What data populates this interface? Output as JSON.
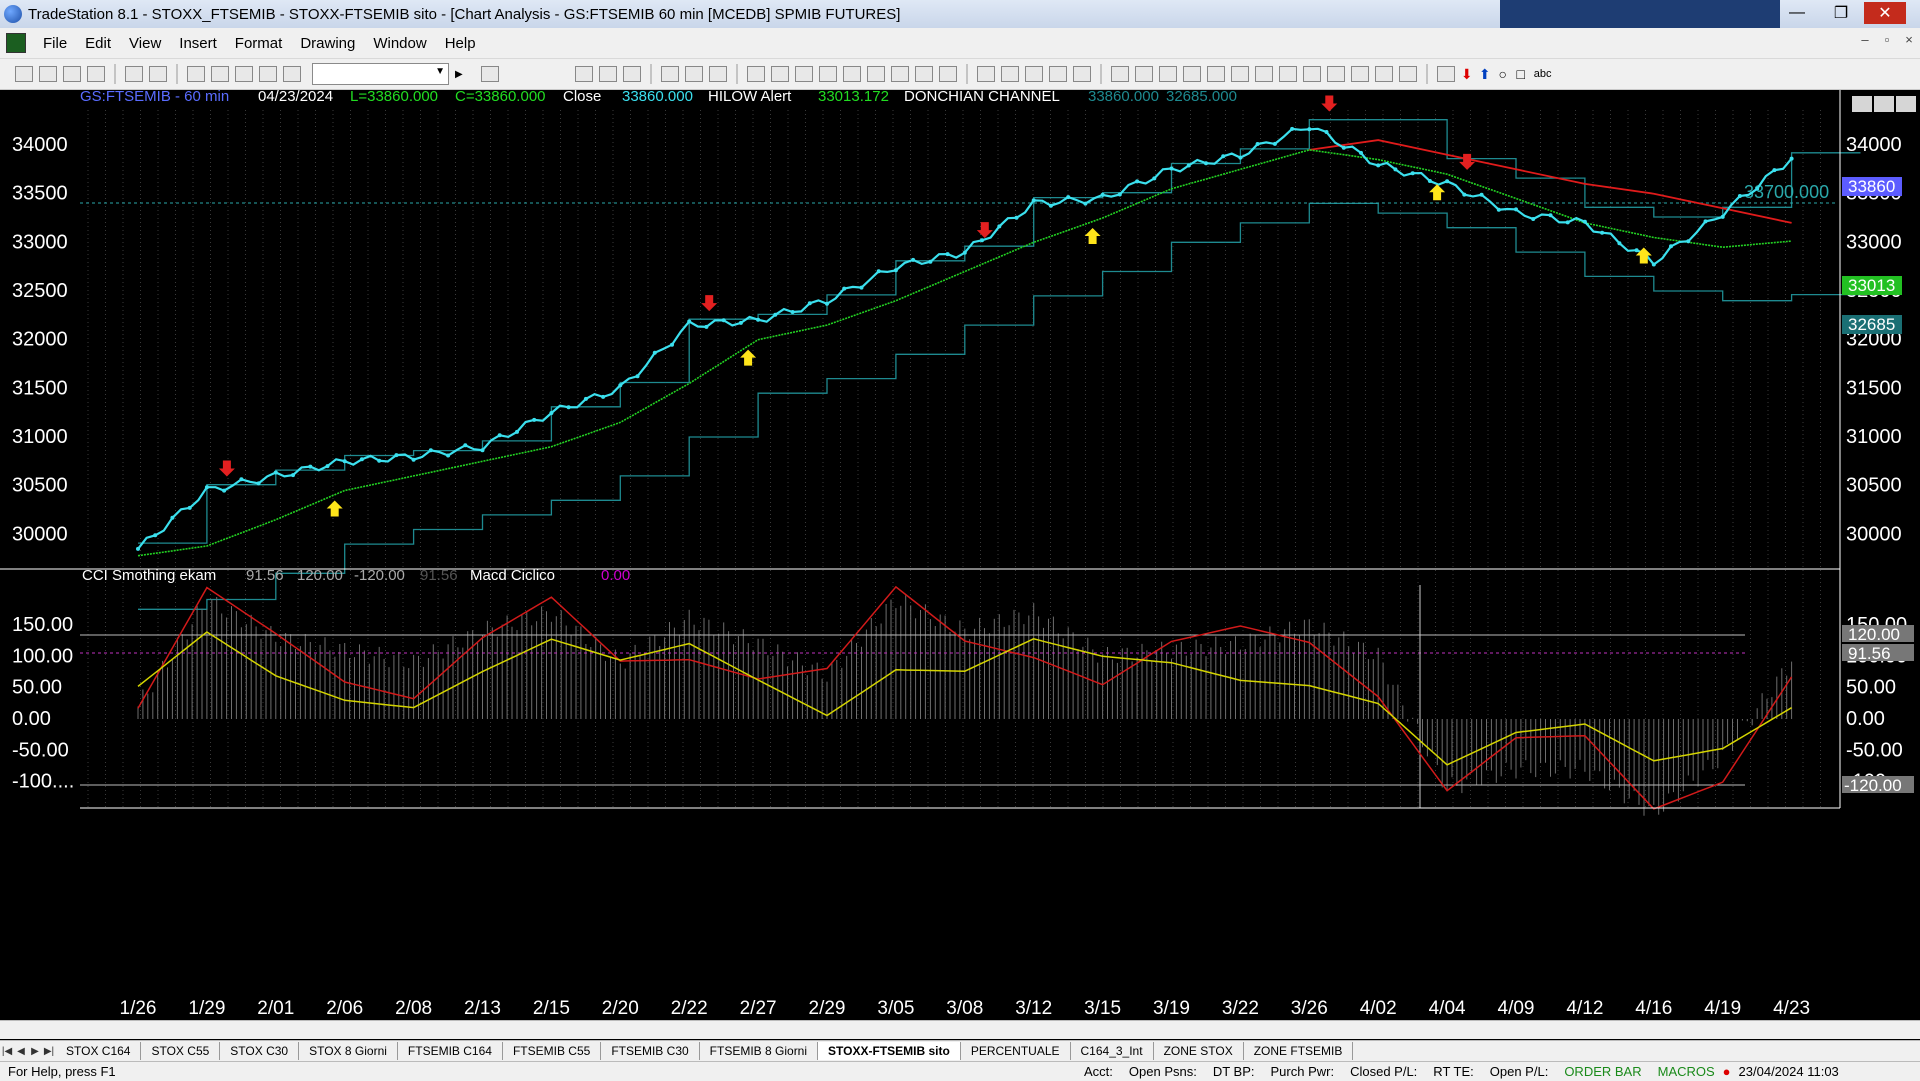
{
  "window": {
    "title": "TradeStation 8.1 - STOXX_FTSEMIB - STOXX-FTSEMIB sito - [Chart Analysis - GS:FTSEMIB  60 min  [MCEDB] SPMIB FUTURES]",
    "controls": [
      "—",
      "❐",
      "✕"
    ]
  },
  "menu": [
    "File",
    "Edit",
    "View",
    "Insert",
    "Format",
    "Drawing",
    "Window",
    "Help"
  ],
  "mdi_controls": [
    "–",
    "▫",
    "×"
  ],
  "header": {
    "symbol": "GS:FTSEMIB - 60 min",
    "date": "04/23/2024",
    "low": "L=33860.000",
    "close": "C=33860.000",
    "close_label": "Close",
    "close_value": "33860.000",
    "hilow_label": "HILOW Alert",
    "hilow_value": "33013.172",
    "donchian_label": "DONCHIAN CHANNEL",
    "donchian_upper": "33860.000",
    "donchian_lower": "32685.000"
  },
  "price_badges": {
    "last_price": "33860",
    "hilow": "33013",
    "lower": "32685",
    "level_label": "33700.000"
  },
  "colors": {
    "price": "#3be0ee",
    "hilow": "#23d223",
    "donchian": "#1e8a90",
    "ma_red": "#e01b1b",
    "arrow_down": "#e32020",
    "arrow_up": "#ffe51a",
    "cci_line": "#d4d400",
    "cci_red": "#d21a1a",
    "macd_label": "#d000d0",
    "badge_last": "#5c5cff",
    "badge_hilow": "#22c022",
    "badge_lower": "#1a6f74"
  },
  "indicator_header": {
    "name": "CCI Smothing ekam",
    "v1": "91.56",
    "v2": "120.00",
    "v3": "-120.00",
    "v4": "91.56",
    "macd_label": "Macd Ciclico",
    "macd_value": "0.00"
  },
  "indicator_badges": {
    "upper": "120.00",
    "current": "91.56",
    "lower": "-120.00"
  },
  "chart_data": [
    {
      "type": "line",
      "title": "GS:FTSEMIB - 60 min",
      "xlabel": "",
      "ylabel": "",
      "x_ticks": [
        "1/26",
        "1/29",
        "2/01",
        "2/06",
        "2/08",
        "2/13",
        "2/15",
        "2/20",
        "2/22",
        "2/27",
        "2/29",
        "3/05",
        "3/08",
        "3/12",
        "3/15",
        "3/19",
        "3/22",
        "3/26",
        "4/02",
        "4/04",
        "4/09",
        "4/12",
        "4/16",
        "4/19",
        "4/23"
      ],
      "y_ticks": [
        30000,
        30500,
        31000,
        31500,
        32000,
        32500,
        33000,
        33500,
        34000
      ],
      "ylim": [
        29600,
        34300
      ],
      "grid": true,
      "series": [
        {
          "name": "Close",
          "x": [
            "1/26",
            "1/29",
            "2/01",
            "2/06",
            "2/08",
            "2/13",
            "2/15",
            "2/20",
            "2/22",
            "2/27",
            "2/29",
            "3/05",
            "3/08",
            "3/12",
            "3/15",
            "3/19",
            "3/22",
            "3/26",
            "4/02",
            "4/04",
            "4/09",
            "4/12",
            "4/16",
            "4/19",
            "4/23"
          ],
          "values": [
            29850,
            30450,
            30600,
            30750,
            30800,
            30900,
            31250,
            31500,
            32150,
            32200,
            32400,
            32750,
            32900,
            33400,
            33450,
            33750,
            33900,
            34200,
            33800,
            33600,
            33300,
            33200,
            32800,
            33300,
            33860
          ]
        },
        {
          "name": "HILOW Alert",
          "x": [
            "1/26",
            "1/29",
            "2/01",
            "2/06",
            "2/08",
            "2/13",
            "2/15",
            "2/20",
            "2/22",
            "2/27",
            "2/29",
            "3/05",
            "3/08",
            "3/12",
            "3/15",
            "3/19",
            "3/22",
            "3/26",
            "4/02",
            "4/04",
            "4/09",
            "4/12",
            "4/16",
            "4/19",
            "4/23"
          ],
          "values": [
            29780,
            29880,
            30150,
            30450,
            30600,
            30750,
            30900,
            31150,
            31550,
            32000,
            32150,
            32400,
            32700,
            33000,
            33250,
            33550,
            33750,
            33950,
            33850,
            33700,
            33450,
            33200,
            33050,
            32950,
            33013
          ]
        }
      ],
      "annotations": {
        "sell_arrows": [
          "1/29",
          "2/22",
          "3/08",
          "3/26",
          "4/04"
        ],
        "buy_arrows": [
          "2/06",
          "2/27",
          "3/15",
          "4/04",
          "4/16"
        ]
      }
    },
    {
      "type": "line",
      "title": "CCI Smothing ekam",
      "xlabel": "",
      "ylabel": "",
      "y_ticks": [
        -100,
        -50,
        0,
        50,
        100,
        150
      ],
      "ylim": [
        -160,
        220
      ],
      "reference_lines": [
        120,
        91.56,
        -120
      ],
      "grid": true,
      "series": [
        {
          "name": "CCI Smothing ekam",
          "x": [
            "1/26",
            "1/29",
            "2/01",
            "2/06",
            "2/08",
            "2/13",
            "2/15",
            "2/20",
            "2/22",
            "2/27",
            "2/29",
            "3/05",
            "3/08",
            "3/12",
            "3/15",
            "3/19",
            "3/22",
            "3/26",
            "4/02",
            "4/04",
            "4/09",
            "4/12",
            "4/16",
            "4/19",
            "4/23"
          ],
          "values": [
            20,
            190,
            130,
            110,
            90,
            140,
            170,
            90,
            160,
            120,
            70,
            190,
            140,
            170,
            100,
            110,
            120,
            150,
            100,
            -110,
            -80,
            -80,
            -150,
            -60,
            91.56
          ]
        }
      ]
    }
  ],
  "tabs": [
    "STOX C164",
    "STOX C55",
    "STOX  C30",
    "STOX  8 Giorni",
    "FTSEMIB C164",
    "FTSEMIB C55",
    "FTSEMIB C30",
    "FTSEMIB  8 Giorni",
    "STOXX-FTSEMIB sito",
    "PERCENTUALE",
    "C164_3_Int",
    "ZONE STOX",
    "ZONE FTSEMIB"
  ],
  "active_tab": "STOXX-FTSEMIB sito",
  "status": {
    "help": "For Help, press F1",
    "acct": "Acct:",
    "open_psns": "Open Psns:",
    "dt_bp": "DT BP:",
    "purch_pwr": "Purch Pwr:",
    "closed_pl": "Closed P/L:",
    "rt_te": "RT TE:",
    "open_pl": "Open P/L:",
    "order_bar": "ORDER BAR",
    "macros": "MACROS",
    "datetime": "23/04/2024 11:03"
  }
}
